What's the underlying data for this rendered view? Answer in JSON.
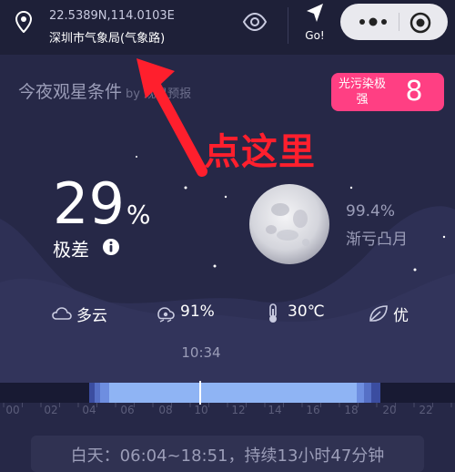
{
  "header": {
    "coordinates": "22.5389N,114.0103E",
    "location_name": "深圳市气象局(气象路)",
    "go_label": "Go!"
  },
  "main": {
    "title": "今夜观星条件",
    "title_by": "by 观星预报",
    "light_pollution": {
      "label": "光污染极强",
      "value": "8",
      "color": "#ff3f83"
    },
    "annotation": "点这里",
    "viewing_percent": "29",
    "viewing_unit": "%",
    "viewing_quality": "极差",
    "moon_illumination": "99.4%",
    "moon_phase": "渐亏凸月"
  },
  "weather": {
    "cloud": "多云",
    "humidity": "91%",
    "temperature": "30℃",
    "air_quality": "优"
  },
  "timeline": {
    "current_time": "10:34",
    "hours": [
      "00",
      "02",
      "04",
      "06",
      "08",
      "10",
      "12",
      "14",
      "16",
      "18",
      "20",
      "22"
    ],
    "daylight": "白天：06:04~18:51，持续13小时47分钟"
  },
  "colors": {
    "background": "#262847",
    "header_bg": "#1e2038",
    "badge": "#ff3f83",
    "annotation_red": "#ff1f2d",
    "day_blue": "#8fb4f4"
  },
  "icons": {
    "location": "location-pin-icon",
    "view": "eye-icon",
    "go": "navigation-arrow-icon",
    "more": "more-dots-icon",
    "close": "close-circle-icon",
    "info": "info-icon",
    "cloud": "cloud-icon",
    "humidity": "humidity-icon",
    "temperature": "thermometer-icon",
    "air": "leaf-icon"
  }
}
